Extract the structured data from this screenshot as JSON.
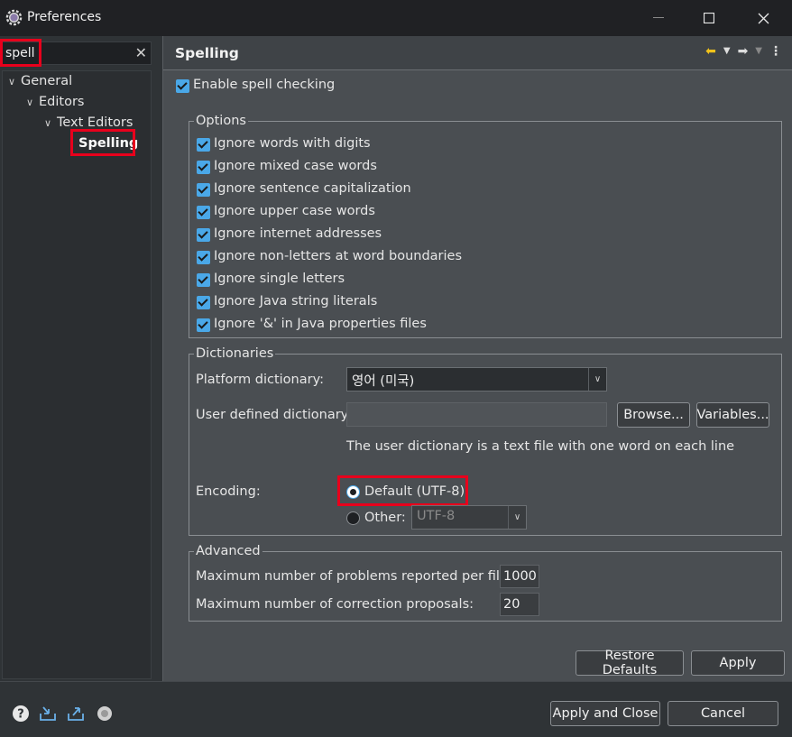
{
  "window": {
    "title": "Preferences",
    "minimize_icon": "minimize-icon",
    "maximize_icon": "maximize-icon",
    "close_icon": "close-icon"
  },
  "filter": {
    "value": "spell"
  },
  "tree": {
    "general": "General",
    "editors": "Editors",
    "text_editors": "Text Editors",
    "spelling": "Spelling"
  },
  "page": {
    "title": "Spelling",
    "enable_spell": "Enable spell checking"
  },
  "options": {
    "title": "Options",
    "items": [
      "Ignore words with digits",
      "Ignore mixed case words",
      "Ignore sentence capitalization",
      "Ignore upper case words",
      "Ignore internet addresses",
      "Ignore non-letters at word boundaries",
      "Ignore single letters",
      "Ignore Java string literals",
      "Ignore '&' in Java properties files"
    ]
  },
  "dictionaries": {
    "title": "Dictionaries",
    "platform_label": "Platform dictionary:",
    "platform_value": "영어 (미국)",
    "user_label": "User defined dictionary:",
    "user_value": "",
    "browse": "Browse...",
    "variables": "Variables...",
    "hint": "The user dictionary is a text file with one word on each line",
    "encoding_label": "Encoding:",
    "default_option": "Default (UTF-8)",
    "other_option": "Other:",
    "other_value": "UTF-8"
  },
  "advanced": {
    "title": "Advanced",
    "max_problems_label": "Maximum number of problems reported per file:",
    "max_problems_value": "1000",
    "max_proposals_label": "Maximum number of correction proposals:",
    "max_proposals_value": "20"
  },
  "buttons": {
    "restore": "Restore Defaults",
    "apply": "Apply",
    "apply_close": "Apply and Close",
    "cancel": "Cancel"
  },
  "colors": {
    "accent": "#4aa8e8",
    "highlight": "#e8001c"
  }
}
